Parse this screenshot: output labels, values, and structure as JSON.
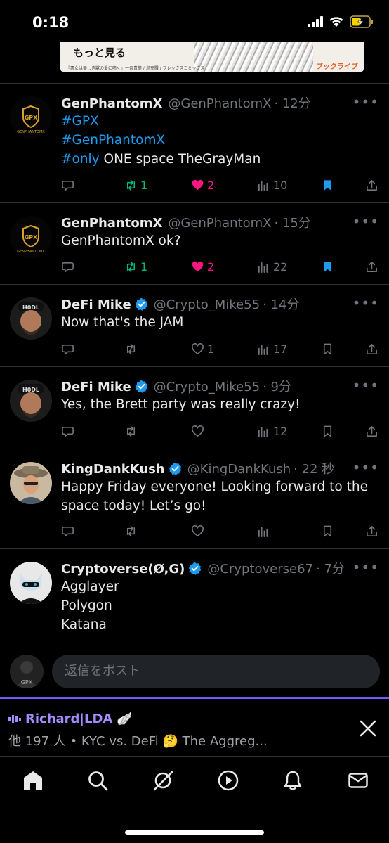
{
  "status": {
    "time": "0:18"
  },
  "ad": {
    "button": "もっと見る",
    "small_text": "『悪女は美しき獣の愛に啼く』一条青葉 / 鳥支羅 / フレックスコミックス",
    "badge": "ブックライブ"
  },
  "tweets": [
    {
      "name": "GenPhantomX",
      "handle": "@GenPhantomX",
      "time": "· 12分",
      "verified": false,
      "lines": [
        [
          {
            "text": "#GPX",
            "tag": true
          }
        ],
        [
          {
            "text": "#GenPhantomX",
            "tag": true
          }
        ],
        [
          {
            "text": "#only",
            "tag": true
          },
          {
            "text": " ONE space TheGrayMan",
            "tag": false
          }
        ]
      ],
      "replies": "",
      "retweets": "1",
      "likes": "2",
      "views": "10",
      "bookmarked": true,
      "retweeted": true,
      "liked": true
    },
    {
      "name": "GenPhantomX",
      "handle": "@GenPhantomX",
      "time": "· 15分",
      "verified": false,
      "lines": [
        [
          {
            "text": "GenPhantomX ok?",
            "tag": false
          }
        ]
      ],
      "replies": "",
      "retweets": "1",
      "likes": "2",
      "views": "22",
      "bookmarked": true,
      "retweeted": true,
      "liked": true
    },
    {
      "name": "DeFi Mike",
      "handle": "@Crypto_Mike55",
      "time": "· 14分",
      "verified": true,
      "lines": [
        [
          {
            "text": "Now that's the JAM",
            "tag": false
          }
        ]
      ],
      "replies": "",
      "retweets": "",
      "likes": "1",
      "views": "17",
      "bookmarked": false,
      "retweeted": false,
      "liked": false
    },
    {
      "name": "DeFi Mike",
      "handle": "@Crypto_Mike55",
      "time": "· 9分",
      "verified": true,
      "lines": [
        [
          {
            "text": "Yes, the Brett party was really crazy!",
            "tag": false
          }
        ]
      ],
      "replies": "",
      "retweets": "",
      "likes": "",
      "views": "12",
      "bookmarked": false,
      "retweeted": false,
      "liked": false
    },
    {
      "name": "KingDankKush",
      "handle": "@KingDankKush",
      "time": "· 22 秒",
      "verified": true,
      "lines": [
        [
          {
            "text": "Happy Friday everyone! Looking forward to the",
            "tag": false
          }
        ],
        [
          {
            "text": "space today! Let’s go!",
            "tag": false
          }
        ]
      ],
      "replies": "",
      "retweets": "",
      "likes": "",
      "views": "",
      "bookmarked": false,
      "retweeted": false,
      "liked": false
    },
    {
      "name": "Cryptoverse(Ø,G)",
      "handle": "@Cryptoverse67",
      "time": "· 7分",
      "verified": true,
      "lines": [
        [
          {
            "text": "Agglayer",
            "tag": false
          }
        ],
        [
          {
            "text": "Polygon",
            "tag": false
          }
        ],
        [
          {
            "text": "Katana",
            "tag": false
          }
        ]
      ],
      "replies": "",
      "retweets": "",
      "likes": "",
      "views": "",
      "bookmarked": false,
      "retweeted": false,
      "liked": false,
      "no_actions": true
    }
  ],
  "reply": {
    "placeholder": "返信をポスト"
  },
  "space": {
    "host": "Richard|LDA",
    "host_emoji": "🪽",
    "subtitle": "他 197 人 • KYC vs. DeFi 🤔 The Aggreg..."
  },
  "tabs": [
    "home-icon",
    "search-icon",
    "grok-icon",
    "video-icon",
    "notifications-icon",
    "messages-icon"
  ],
  "colors": {
    "accent": "#1d9bf0",
    "retweet": "#00ba7c",
    "like": "#f91880",
    "space": "#7856ff"
  }
}
